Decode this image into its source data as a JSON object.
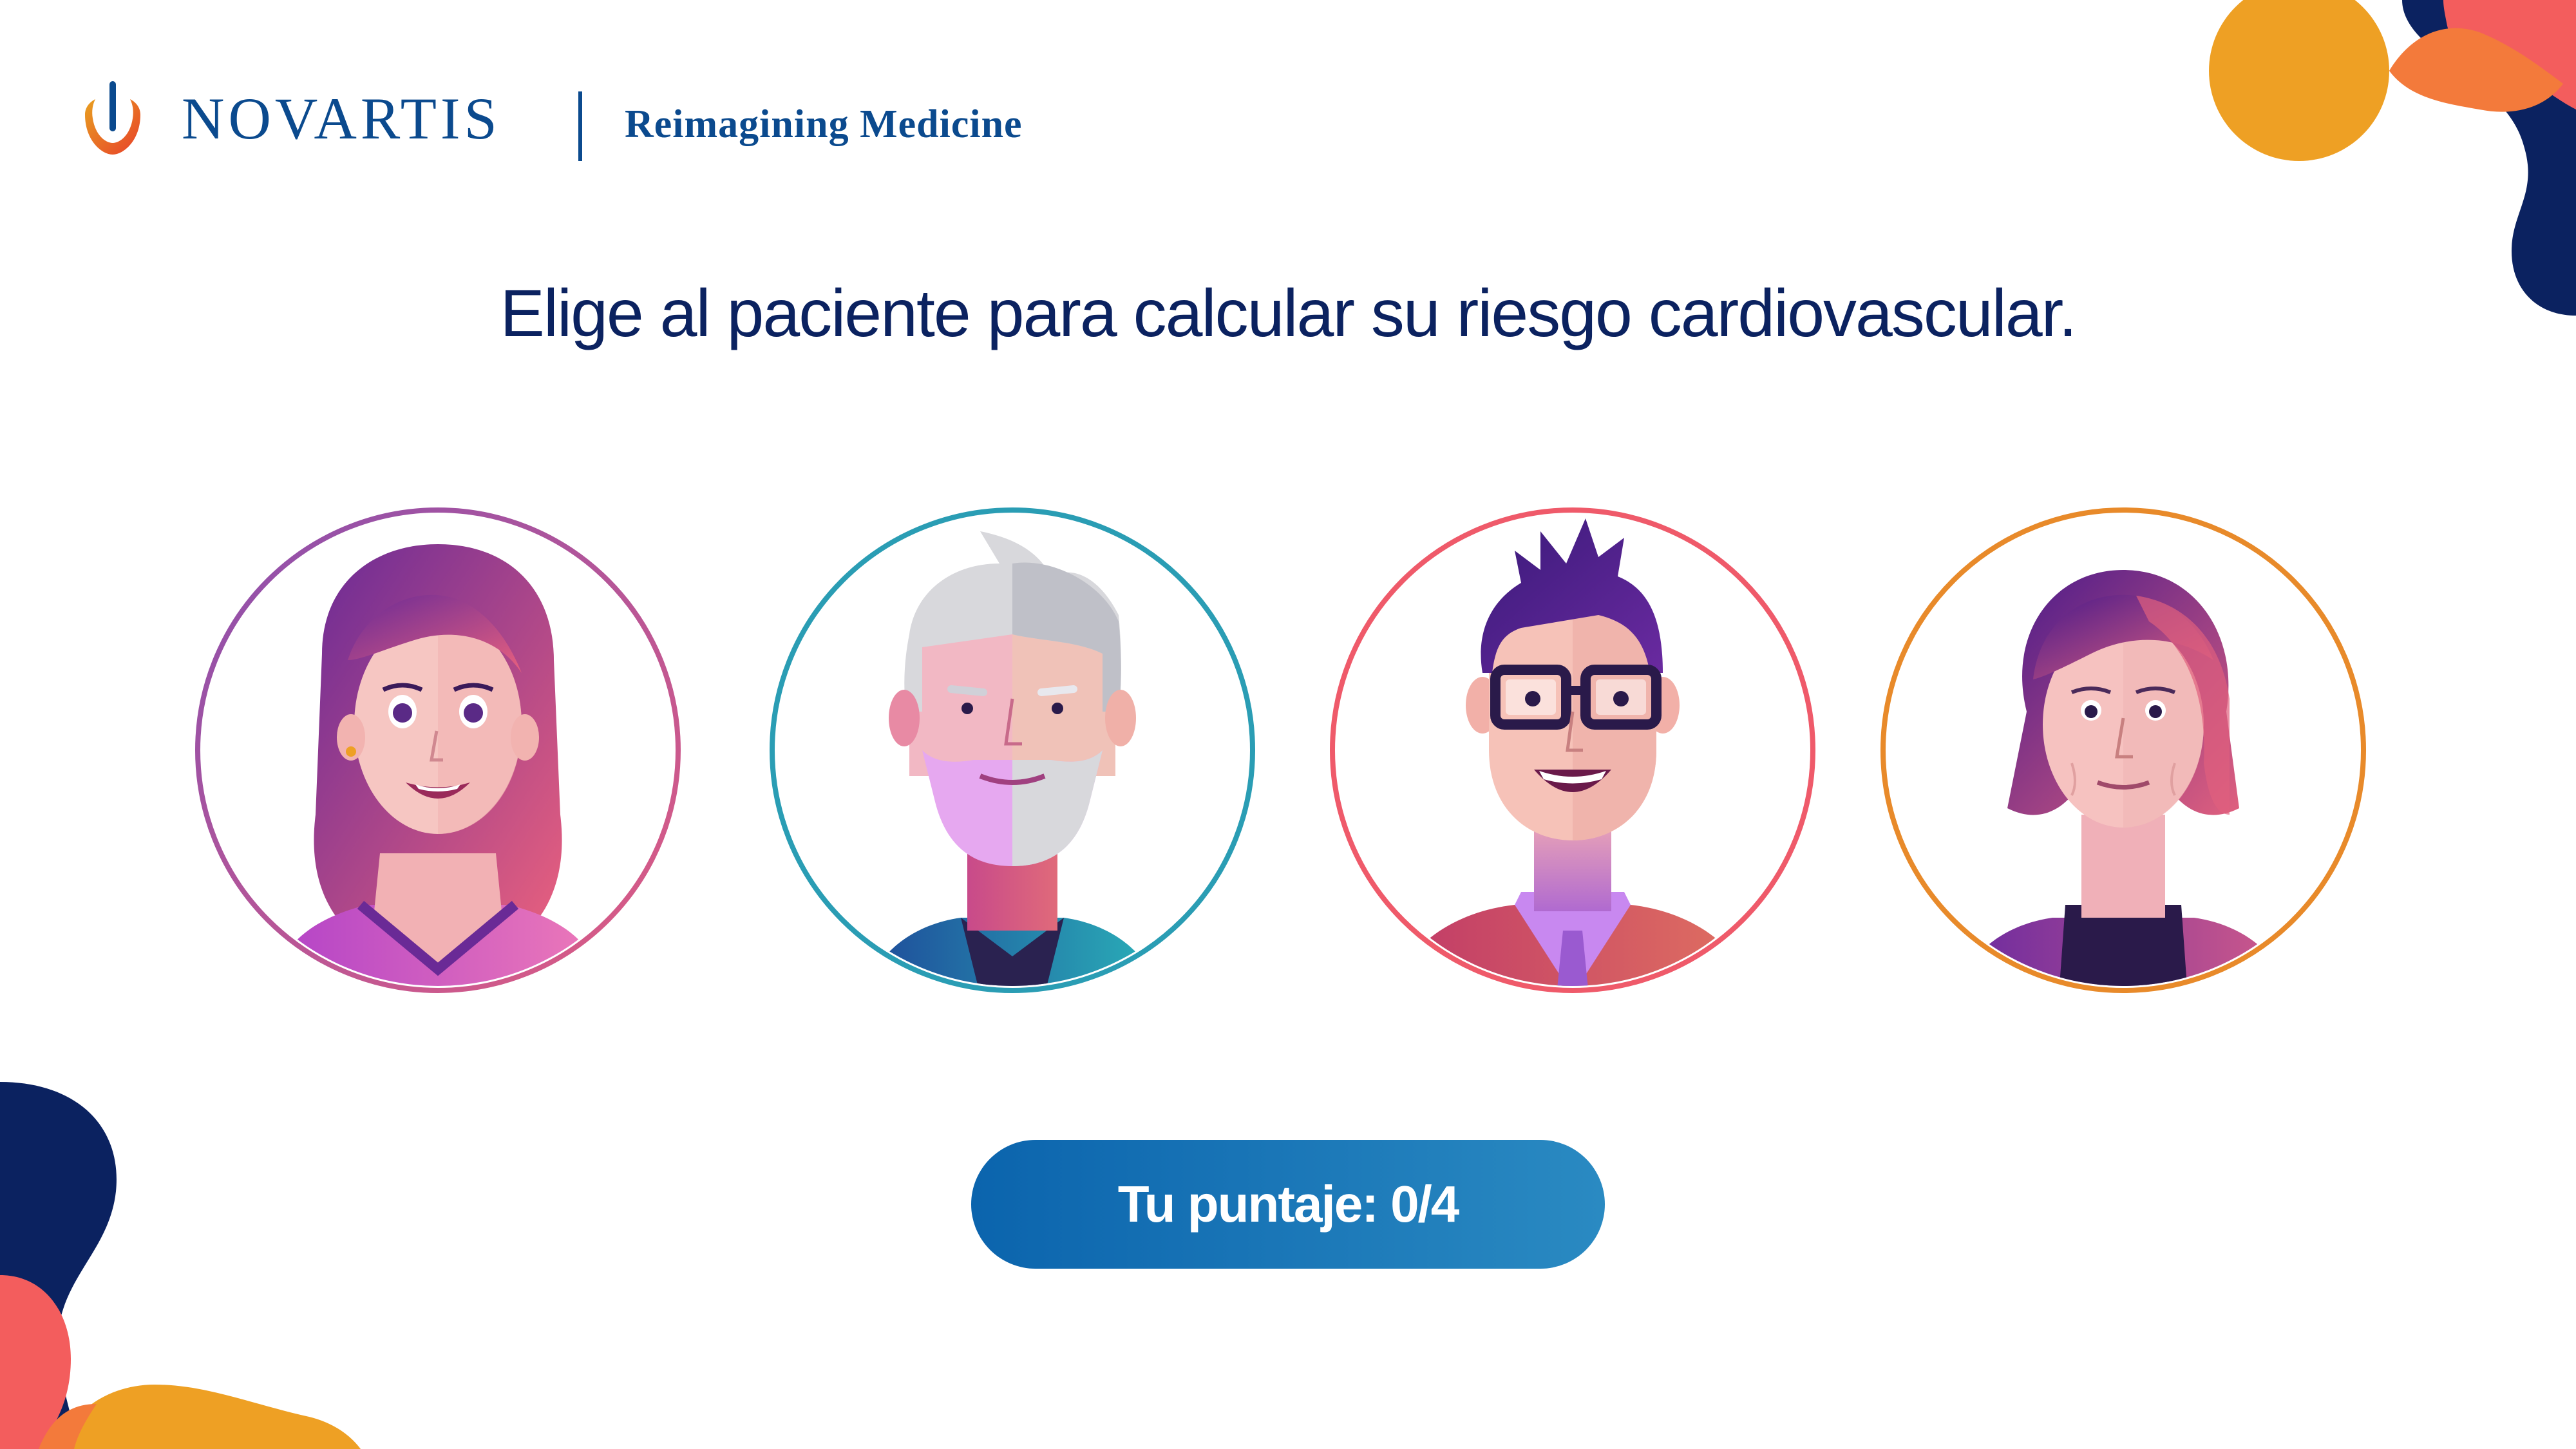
{
  "brand": {
    "name": "NOVARTIS",
    "tagline": "Reimagining Medicine"
  },
  "title": "Elige al paciente para calcular su riesgo cardiovascular.",
  "patients": [
    {
      "avatar": "young-woman-avatar",
      "ring_color": "#9a52b0"
    },
    {
      "avatar": "older-bearded-man-avatar",
      "ring_color": "#2a9db4"
    },
    {
      "avatar": "young-man-glasses-avatar",
      "ring_color": "#ef5a6a"
    },
    {
      "avatar": "older-woman-avatar",
      "ring_color": "#e88a2a"
    }
  ],
  "score": {
    "label": "Tu puntaje: 0/4"
  },
  "colors": {
    "navy": "#0b2260",
    "brand_blue": "#0b4a8e",
    "orange": "#eea024",
    "coral": "#f35d5d"
  }
}
